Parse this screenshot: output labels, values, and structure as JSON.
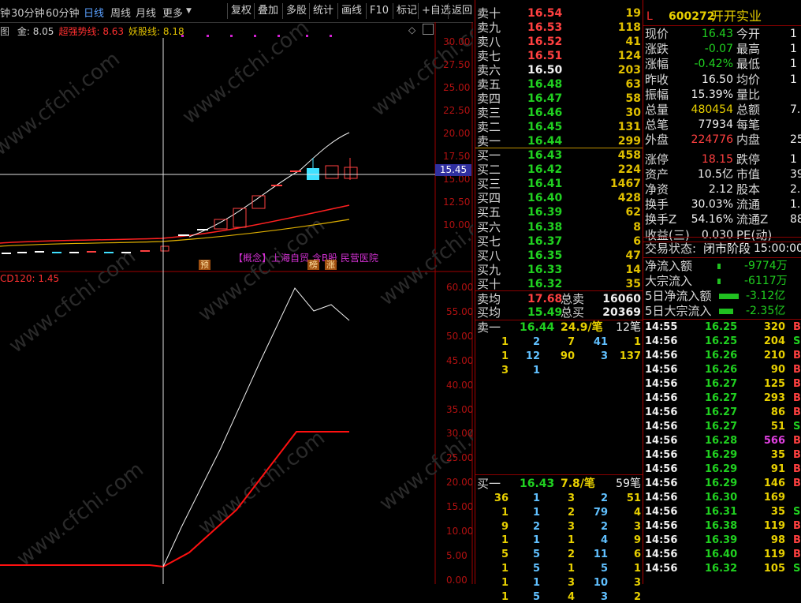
{
  "toolbar": {
    "periods": [
      "钟",
      "30分钟",
      "60分钟",
      "日线",
      "周线",
      "月线",
      "更多"
    ],
    "active_period": "日线",
    "buttons": [
      "复权",
      "叠加",
      "多股",
      "统计",
      "画线",
      "F10",
      "标记",
      "+自选",
      "返回"
    ]
  },
  "chart": {
    "indicator_line": [
      {
        "label": "金",
        "value": "8.05",
        "color": "#d0d0d0"
      },
      {
        "label": "超强势线",
        "value": "8.63",
        "color": "#ff3030"
      },
      {
        "label": "妖股线",
        "value": "8.18",
        "color": "#e0c000"
      }
    ],
    "prefix": "图",
    "crosshair_price": "15.45",
    "price_ticks": [
      "30.00",
      "27.50",
      "25.00",
      "22.50",
      "20.00",
      "17.50",
      "15.00",
      "12.50",
      "10.00"
    ],
    "concept_text": "【概念】上海自贸 含B股 民营医院",
    "markers": [
      "预",
      "榜",
      "涨"
    ],
    "lower_indicator": "CD120: 1.45",
    "lower_ticks": [
      "60.00",
      "55.00",
      "50.00",
      "45.00",
      "40.00",
      "35.00",
      "30.00",
      "25.00",
      "20.00",
      "15.00",
      "10.00",
      "5.00",
      "0.00"
    ],
    "watermark": "www.cfchi.com"
  },
  "order_book": {
    "asks": [
      {
        "label": "卖十",
        "price": "16.54",
        "vol": "19",
        "color": "red"
      },
      {
        "label": "卖九",
        "price": "16.53",
        "vol": "118",
        "color": "red"
      },
      {
        "label": "卖八",
        "price": "16.52",
        "vol": "41",
        "color": "red"
      },
      {
        "label": "卖七",
        "price": "16.51",
        "vol": "124",
        "color": "red"
      },
      {
        "label": "卖六",
        "price": "16.50",
        "vol": "203",
        "color": "wht"
      },
      {
        "label": "卖五",
        "price": "16.48",
        "vol": "63",
        "color": "grn"
      },
      {
        "label": "卖四",
        "price": "16.47",
        "vol": "58",
        "color": "grn"
      },
      {
        "label": "卖三",
        "price": "16.46",
        "vol": "30",
        "color": "grn"
      },
      {
        "label": "卖二",
        "price": "16.45",
        "vol": "131",
        "color": "grn"
      },
      {
        "label": "卖一",
        "price": "16.44",
        "vol": "299",
        "color": "grn"
      }
    ],
    "bids": [
      {
        "label": "买一",
        "price": "16.43",
        "vol": "458",
        "color": "grn"
      },
      {
        "label": "买二",
        "price": "16.42",
        "vol": "224",
        "color": "grn"
      },
      {
        "label": "买三",
        "price": "16.41",
        "vol": "1467",
        "color": "grn"
      },
      {
        "label": "买四",
        "price": "16.40",
        "vol": "428",
        "color": "grn"
      },
      {
        "label": "买五",
        "price": "16.39",
        "vol": "62",
        "color": "grn"
      },
      {
        "label": "买六",
        "price": "16.38",
        "vol": "8",
        "color": "grn"
      },
      {
        "label": "买七",
        "price": "16.37",
        "vol": "6",
        "color": "grn"
      },
      {
        "label": "买八",
        "price": "16.35",
        "vol": "47",
        "color": "grn"
      },
      {
        "label": "买九",
        "price": "16.33",
        "vol": "14",
        "color": "grn"
      },
      {
        "label": "买十",
        "price": "16.32",
        "vol": "35",
        "color": "grn"
      }
    ],
    "avg": [
      {
        "label": "卖均",
        "price": "17.68",
        "sub": "总卖",
        "vol": "16060",
        "color": "red"
      },
      {
        "label": "买均",
        "price": "15.49",
        "sub": "总买",
        "vol": "20369",
        "color": "grn"
      }
    ],
    "sell_queue": {
      "label": "卖一",
      "price": "16.44",
      "amount": "24.9/笔",
      "count": "12笔",
      "rows": [
        [
          "1",
          "2",
          "7",
          "41",
          "1"
        ],
        [
          "1",
          "12",
          "90",
          "3",
          "137"
        ],
        [
          "3",
          "1",
          "",
          "",
          ""
        ]
      ]
    },
    "buy_queue": {
      "label": "买一",
      "price": "16.43",
      "amount": "7.8/笔",
      "count": "59笔",
      "rows": [
        [
          "36",
          "1",
          "3",
          "2",
          "51"
        ],
        [
          "1",
          "1",
          "2",
          "79",
          "4"
        ],
        [
          "9",
          "2",
          "3",
          "2",
          "3"
        ],
        [
          "1",
          "1",
          "1",
          "4",
          "9"
        ],
        [
          "5",
          "5",
          "2",
          "11",
          "6"
        ],
        [
          "1",
          "5",
          "1",
          "5",
          "1"
        ],
        [
          "1",
          "1",
          "3",
          "10",
          "3"
        ],
        [
          "1",
          "5",
          "4",
          "3",
          "2"
        ]
      ]
    }
  },
  "quote": {
    "code": "600272",
    "name": "开开实业",
    "flag": "L",
    "fields": [
      {
        "k": "现价",
        "v": "16.43",
        "vc": "grn",
        "k2": "今开",
        "v2": "1"
      },
      {
        "k": "涨跌",
        "v": "-0.07",
        "vc": "grn",
        "k2": "最高",
        "v2": "1"
      },
      {
        "k": "涨幅",
        "v": "-0.42%",
        "vc": "grn",
        "k2": "最低",
        "v2": "1"
      },
      {
        "k": "昨收",
        "v": "16.50",
        "vc": "wht",
        "k2": "均价",
        "v2": "1"
      },
      {
        "k": "振幅",
        "v": "15.39%",
        "vc": "wht",
        "k2": "量比",
        "v2": ""
      },
      {
        "k": "总量",
        "v": "480454",
        "vc": "yel",
        "k2": "总额",
        "v2": "7."
      },
      {
        "k": "总笔",
        "v": "77934",
        "vc": "wht",
        "k2": "每笔",
        "v2": ""
      },
      {
        "k": "外盘",
        "v": "224776",
        "vc": "red",
        "k2": "内盘",
        "v2": "25"
      },
      {
        "k": "涨停",
        "v": "18.15",
        "vc": "red",
        "k2": "跌停",
        "v2": "1"
      },
      {
        "k": "资产",
        "v": "10.5亿",
        "vc": "wht",
        "k2": "市值",
        "v2": "39"
      },
      {
        "k": "净资",
        "v": "2.12",
        "vc": "wht",
        "k2": "股本",
        "v2": "2."
      },
      {
        "k": "换手",
        "v": "30.03%",
        "vc": "wht",
        "k2": "流通",
        "v2": "1."
      },
      {
        "k": "换手Z",
        "v": "54.16%",
        "vc": "wht",
        "k2": "流通Z",
        "v2": "88"
      },
      {
        "k": "收益(三)",
        "v": "0.030",
        "vc": "wht",
        "k2": "PE(动)",
        "v2": ""
      }
    ],
    "status_label": "交易状态:",
    "status": "闭市阶段",
    "status_time": "15:00:00",
    "flows": [
      {
        "k": "净流入额",
        "v": "-9774万",
        "bar": 0.05
      },
      {
        "k": "大宗流入",
        "v": "-6117万",
        "bar": 0.04
      },
      {
        "k": "5日净流入额",
        "v": "-3.12亿",
        "bar": 0.7
      },
      {
        "k": "5日大宗流入",
        "v": "-2.35亿",
        "bar": 0.5
      }
    ],
    "ticks": [
      {
        "t": "14:55",
        "p": "16.25",
        "v": "320",
        "s": "B"
      },
      {
        "t": "14:56",
        "p": "16.25",
        "v": "204",
        "s": "S"
      },
      {
        "t": "14:56",
        "p": "16.26",
        "v": "210",
        "s": "B"
      },
      {
        "t": "14:56",
        "p": "16.26",
        "v": "90",
        "s": "B"
      },
      {
        "t": "14:56",
        "p": "16.27",
        "v": "125",
        "s": "B"
      },
      {
        "t": "14:56",
        "p": "16.27",
        "v": "293",
        "s": "B"
      },
      {
        "t": "14:56",
        "p": "16.27",
        "v": "86",
        "s": "B"
      },
      {
        "t": "14:56",
        "p": "16.27",
        "v": "51",
        "s": "S"
      },
      {
        "t": "14:56",
        "p": "16.28",
        "v": "566",
        "s": "B"
      },
      {
        "t": "14:56",
        "p": "16.29",
        "v": "35",
        "s": "B"
      },
      {
        "t": "14:56",
        "p": "16.29",
        "v": "91",
        "s": "B"
      },
      {
        "t": "14:56",
        "p": "16.29",
        "v": "146",
        "s": "B"
      },
      {
        "t": "14:56",
        "p": "16.30",
        "v": "169",
        "s": ""
      },
      {
        "t": "14:56",
        "p": "16.31",
        "v": "35",
        "s": "S"
      },
      {
        "t": "14:56",
        "p": "16.38",
        "v": "119",
        "s": "B"
      },
      {
        "t": "14:56",
        "p": "16.39",
        "v": "98",
        "s": "B"
      },
      {
        "t": "14:56",
        "p": "16.40",
        "v": "119",
        "s": "B"
      },
      {
        "t": "14:56",
        "p": "16.32",
        "v": "105",
        "s": "S"
      }
    ]
  }
}
